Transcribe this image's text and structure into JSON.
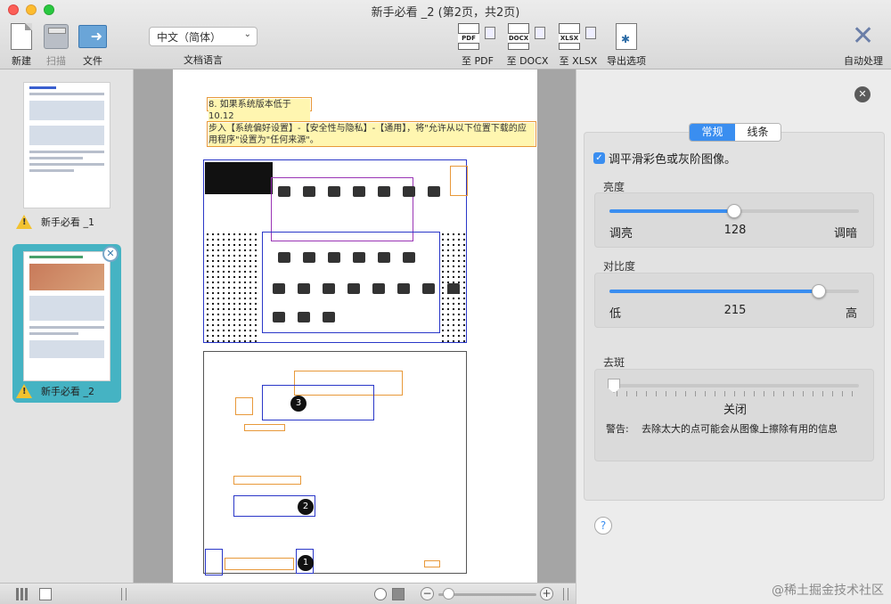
{
  "window": {
    "title": "新手必看 _2 (第2页，共2页)"
  },
  "toolbar": {
    "new_label": "新建",
    "scan_label": "扫描",
    "file_label": "文件",
    "language_value": "中文（简体）",
    "language_label": "文档语言",
    "pdf_icon_text": "PDF",
    "pdf_label": "至 PDF",
    "docx_icon_text": "DOCX",
    "docx_label": "至 DOCX",
    "xlsx_icon_text": "XLSX",
    "xlsx_label": "至 XLSX",
    "export_label": "导出选项",
    "auto_label": "自动处理"
  },
  "sidebar": {
    "pages": [
      {
        "label": "新手必看 _1"
      },
      {
        "label": "新手必看 _2"
      }
    ]
  },
  "document": {
    "line1": "8. 如果系统版本低于 10.12",
    "line2": "步入【系统偏好设置】-【安全性与隐私】-【通用】，将\"允许从以下位置下载的应用程序\"设置为\"任何来源\"。",
    "num1": "1",
    "num2": "2",
    "num3": "3"
  },
  "panel": {
    "tab_general": "常规",
    "tab_lines": "线条",
    "smooth_label": "调平滑彩色或灰阶图像。",
    "brightness": {
      "title": "亮度",
      "left": "调亮",
      "right": "调暗",
      "value": "128",
      "fraction": 0.5
    },
    "contrast": {
      "title": "对比度",
      "left": "低",
      "right": "高",
      "value": "215",
      "fraction": 0.84
    },
    "despeckle": {
      "title": "去斑",
      "value": "关闭",
      "warning_label": "警告:",
      "warning": "去除太大的点可能会从图像上擦除有用的信息",
      "fraction": 0
    },
    "help": "?"
  },
  "watermark": "@稀土掘金技术社区",
  "colors": {
    "accent": "#3a8ef0",
    "selection": "#45b3c3",
    "zone_orange": "#e8993a",
    "zone_blue": "#2a37c8",
    "zone_purple": "#9a35b5"
  }
}
